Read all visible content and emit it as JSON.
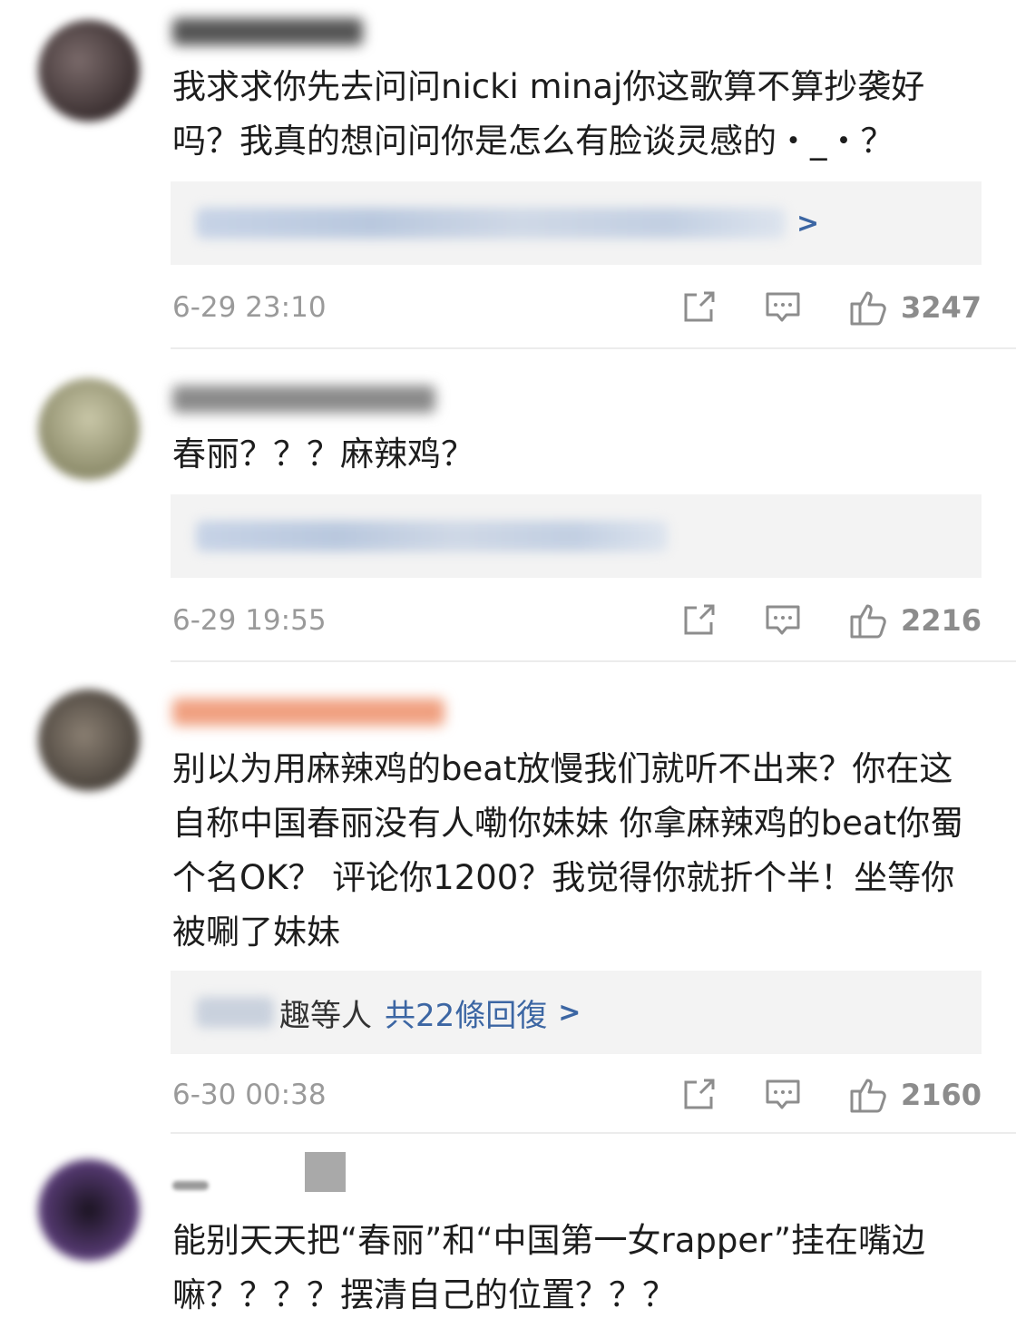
{
  "comments": [
    {
      "username": "..tnugot_AG",
      "text": "我求求你先去问问nicki minaj你这歌算不算抄袭好吗？我真的想问问你是怎么有脸谈灵感的・_・？",
      "replies": {
        "summary": "…等人 共…條回復"
      },
      "timestamp": "6-29 23:10",
      "likes": "3247"
    },
    {
      "username": "",
      "text": "春丽？？？麻辣鸡？",
      "replies": {
        "summary": ""
      },
      "timestamp": "6-29 19:55",
      "likes": "2216"
    },
    {
      "username": "",
      "text": "别以为用麻辣鸡的beat放慢我们就听不出来？你在这自称中国春丽没有人嘞你妹妹 你拿麻辣鸡的beat你蜀个名OK？ 评论你1200？我觉得你就折个半！坐等你被唰了妹妹",
      "replies": {
        "name_tail": "趣等人",
        "count_label": "共22條回復",
        "arrow": ">"
      },
      "timestamp": "6-30 00:38",
      "likes": "2160"
    },
    {
      "username": "",
      "text": "能别天天把“春丽”和“中国第一女rapper”挂在嘴边嘛？？？？摆清自己的位置？？？",
      "timestamp": "",
      "likes": ""
    }
  ],
  "icons": {
    "share": "share-icon",
    "reply": "comment-icon",
    "like": "thumbs-up-icon"
  },
  "colors": {
    "link": "#3c66a3",
    "meta": "#9a9a9a",
    "reply_bg": "#f3f3f3"
  }
}
